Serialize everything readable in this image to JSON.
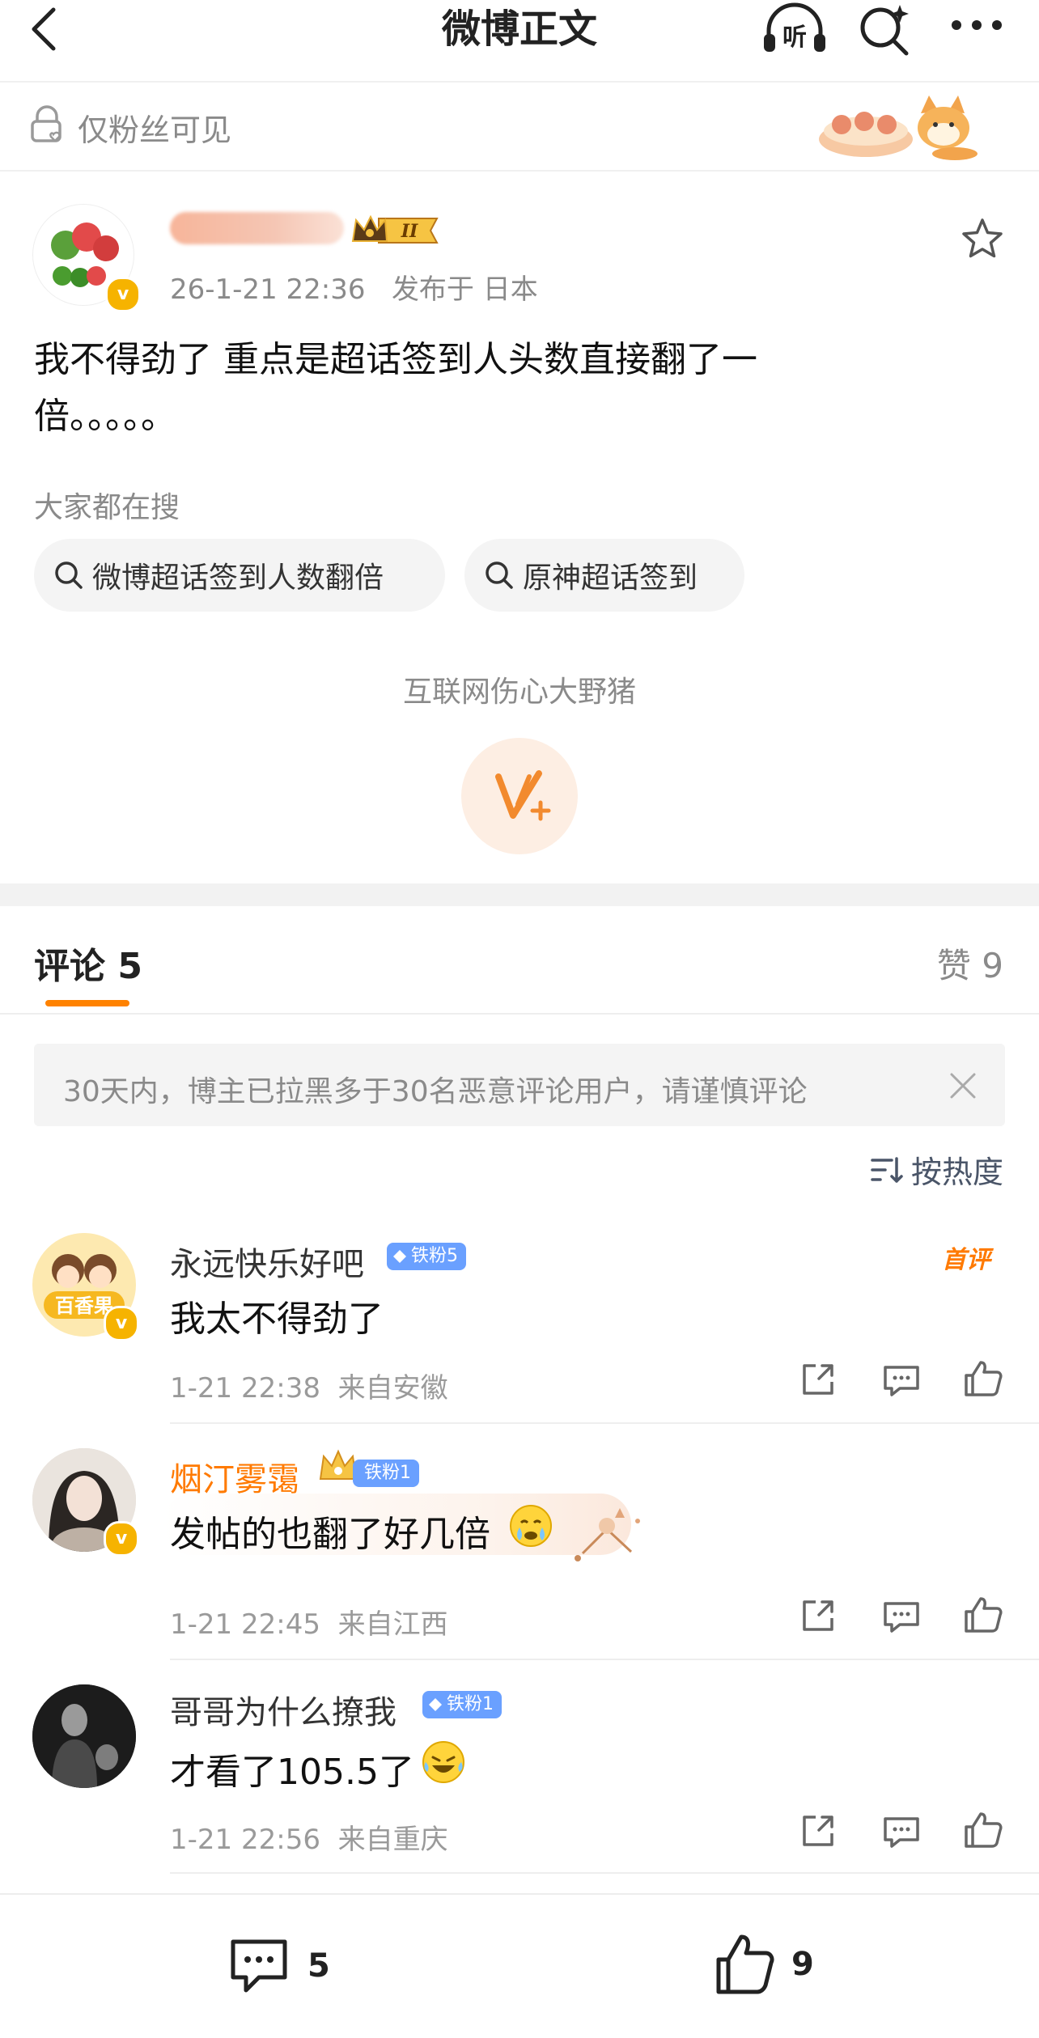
{
  "header": {
    "title": "微博正文",
    "back_icon": "back-chevron-icon",
    "listen_label": "听"
  },
  "visibility": {
    "label": "仅粉丝可见"
  },
  "post": {
    "timestamp": "26-1-21 22:36",
    "location": "发布于 日本",
    "text_line1": "我不得劲了 重点是超话签到人头数直接翻了一",
    "text_line2": "倍。。。。。",
    "level_badge": "II"
  },
  "search": {
    "section_label": "大家都在搜",
    "chips": [
      "微博超话签到人数翻倍",
      "原神超话签到"
    ]
  },
  "promo": {
    "label": "互联网伤心大野猪"
  },
  "comments": {
    "tab_label": "评论 5",
    "likes_label": "赞 9",
    "notice": "30天内，博主已拉黑多于30名恶意评论用户，请谨慎评论",
    "sort_label": "按热度",
    "items": [
      {
        "name": "永远快乐好吧",
        "badge": "铁粉5",
        "text": "我太不得劲了",
        "time": "1-21 22:38",
        "location": "来自安徽",
        "tag": "首评",
        "avatar_text": "百香果"
      },
      {
        "name": "烟汀雾霭",
        "badge": "铁粉1",
        "text": "发帖的也翻了好几倍",
        "time": "1-21 22:45",
        "location": "来自江西"
      },
      {
        "name": "哥哥为什么撩我",
        "badge": "铁粉1",
        "text": "才看了105.5了",
        "time": "1-21 22:56",
        "location": "来自重庆"
      }
    ]
  },
  "bottom": {
    "comment_count": "5",
    "like_count": "9"
  },
  "colors": {
    "accent": "#ff8200",
    "fan_badge": "#6aa0ff",
    "verified": "#f6b300"
  }
}
